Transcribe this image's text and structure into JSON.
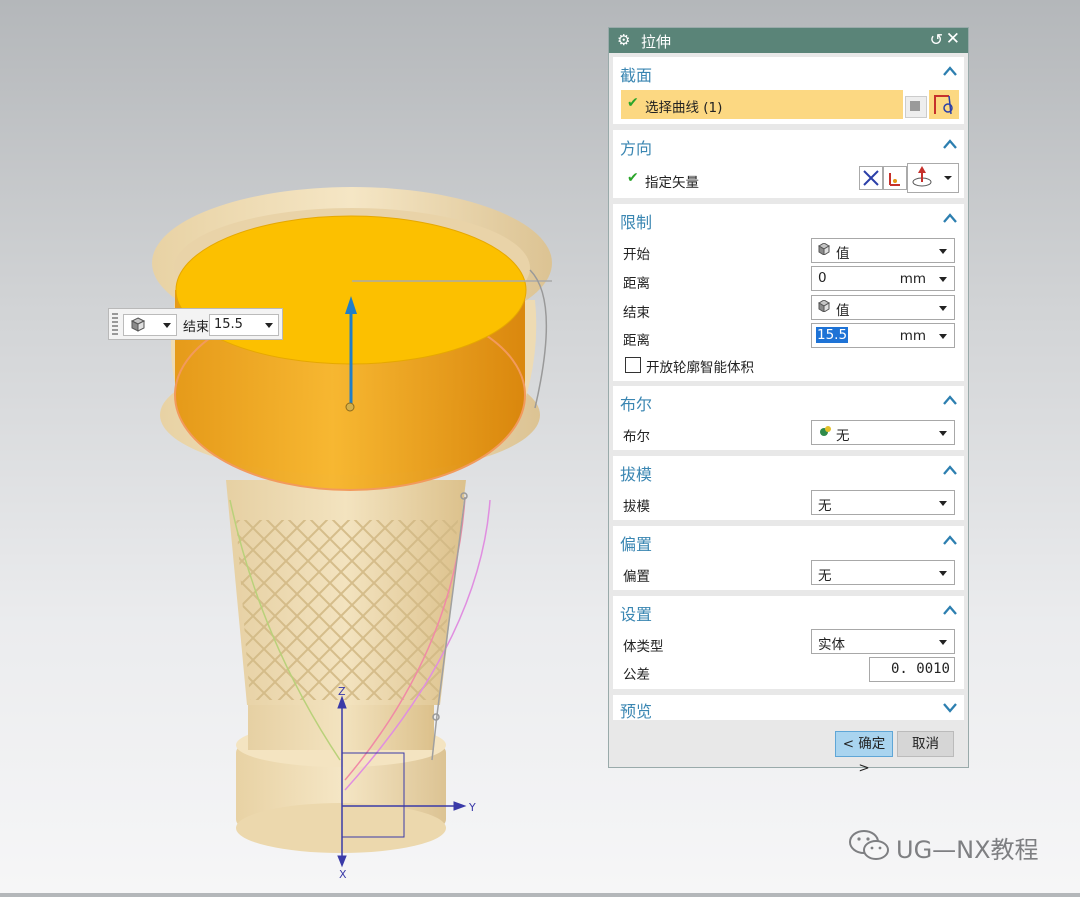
{
  "viewport": {
    "axis_labels": {
      "z": "Z",
      "y": "Y",
      "x": "X"
    }
  },
  "onscreen_input": {
    "mode_icon": "cube-value-icon",
    "label": "结束",
    "value": "15.5"
  },
  "dialog": {
    "title": "拉伸",
    "sections": {
      "section": {
        "header": "截面",
        "select_curve_label": "选择曲线 (1)"
      },
      "direction": {
        "header": "方向",
        "specify_vector_label": "指定矢量"
      },
      "limits": {
        "header": "限制",
        "start_label": "开始",
        "start_value": "值",
        "start_distance_label": "距离",
        "start_distance_value": "0",
        "start_distance_unit": "mm",
        "end_label": "结束",
        "end_value": "值",
        "end_distance_label": "距离",
        "end_distance_value": "15.5",
        "end_distance_unit": "mm",
        "open_profile_label": "开放轮廓智能体积"
      },
      "boolean": {
        "header": "布尔",
        "label": "布尔",
        "value": "无"
      },
      "draft": {
        "header": "拔模",
        "label": "拔模",
        "value": "无"
      },
      "offset": {
        "header": "偏置",
        "label": "偏置",
        "value": "无"
      },
      "settings": {
        "header": "设置",
        "body_type_label": "体类型",
        "body_type_value": "实体",
        "tolerance_label": "公差",
        "tolerance_value": "0. 0010"
      },
      "preview": {
        "header": "预览"
      }
    },
    "buttons": {
      "ok": "< 确定 >",
      "cancel": "取消"
    }
  },
  "watermark": {
    "text": "UG—NX教程",
    "icon": "wechat-icon"
  },
  "colors": {
    "titlebar": "#5a8478",
    "section_header": "#3a86b2",
    "highlight_row": "#fcd882",
    "extrude_top": "#fcc000",
    "extrude_side": "#e8970b",
    "ok_button": "#a9d4ef"
  }
}
